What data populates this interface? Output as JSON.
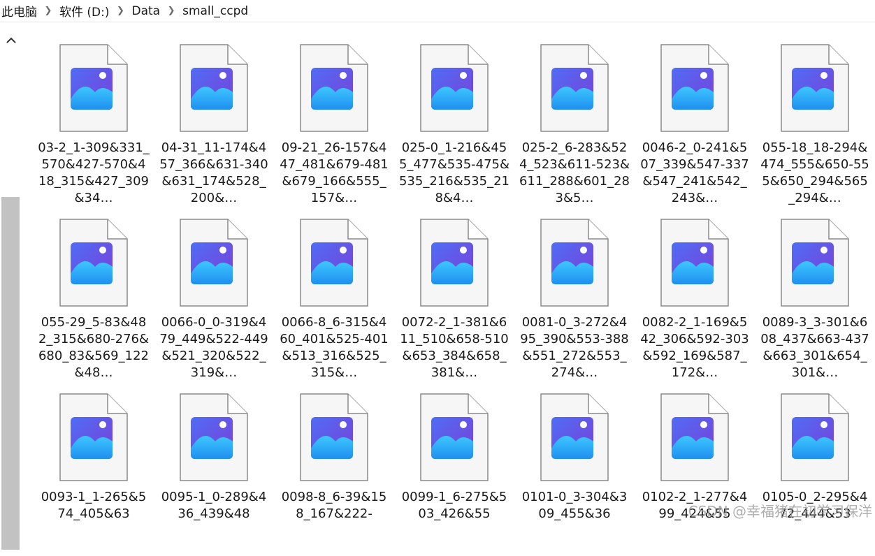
{
  "breadcrumb": {
    "items": [
      "此电脑",
      "软件 (D:)",
      "Data",
      "small_ccpd"
    ]
  },
  "colors": {
    "accent": "#0078d4",
    "icon_gradient_top": "#4f6df5",
    "icon_gradient_bottom": "#35c8ff"
  },
  "files": [
    {
      "name": "03-2_1-309&331_570&427-570&418_315&427_309&34…"
    },
    {
      "name": "04-31_11-174&457_366&631-340&631_174&528_200&…"
    },
    {
      "name": "09-21_26-157&447_481&679-481&679_166&555_157&…"
    },
    {
      "name": "025-0_1-216&455_477&535-475&535_216&535_218&4…"
    },
    {
      "name": "025-2_6-283&524_523&611-523&611_288&601_283&5…"
    },
    {
      "name": "0046-2_0-241&507_339&547-337&547_241&542_243&…"
    },
    {
      "name": "055-18_18-294&474_555&650-555&650_294&565_294&…"
    },
    {
      "name": "055-29_5-83&482_315&680-276&680_83&569_122&48…"
    },
    {
      "name": "0066-0_0-319&479_449&522-449&521_320&522_319&…"
    },
    {
      "name": "0066-8_6-315&460_401&525-401&513_316&525_315&…"
    },
    {
      "name": "0072-2_1-381&611_510&658-510&653_384&658_381&…"
    },
    {
      "name": "0081-0_3-272&495_390&553-388&551_272&553_274&…"
    },
    {
      "name": "0082-2_1-169&542_306&592-303&592_169&587_172&…"
    },
    {
      "name": "0089-3_3-301&608_437&663-437&663_301&654_301&…"
    },
    {
      "name": "0093-1_1-265&574_405&63"
    },
    {
      "name": "0095-1_0-289&436_439&48"
    },
    {
      "name": "0098-8_6-39&158_167&222-"
    },
    {
      "name": "0099-1_6-275&503_426&55"
    },
    {
      "name": "0101-0_3-304&309_455&36"
    },
    {
      "name": "0102-2_1-277&499_424&55"
    },
    {
      "name": "0105-0_2-295&472_444&53"
    }
  ],
  "watermark": "CSDN @幸福猪在初学习保洋"
}
